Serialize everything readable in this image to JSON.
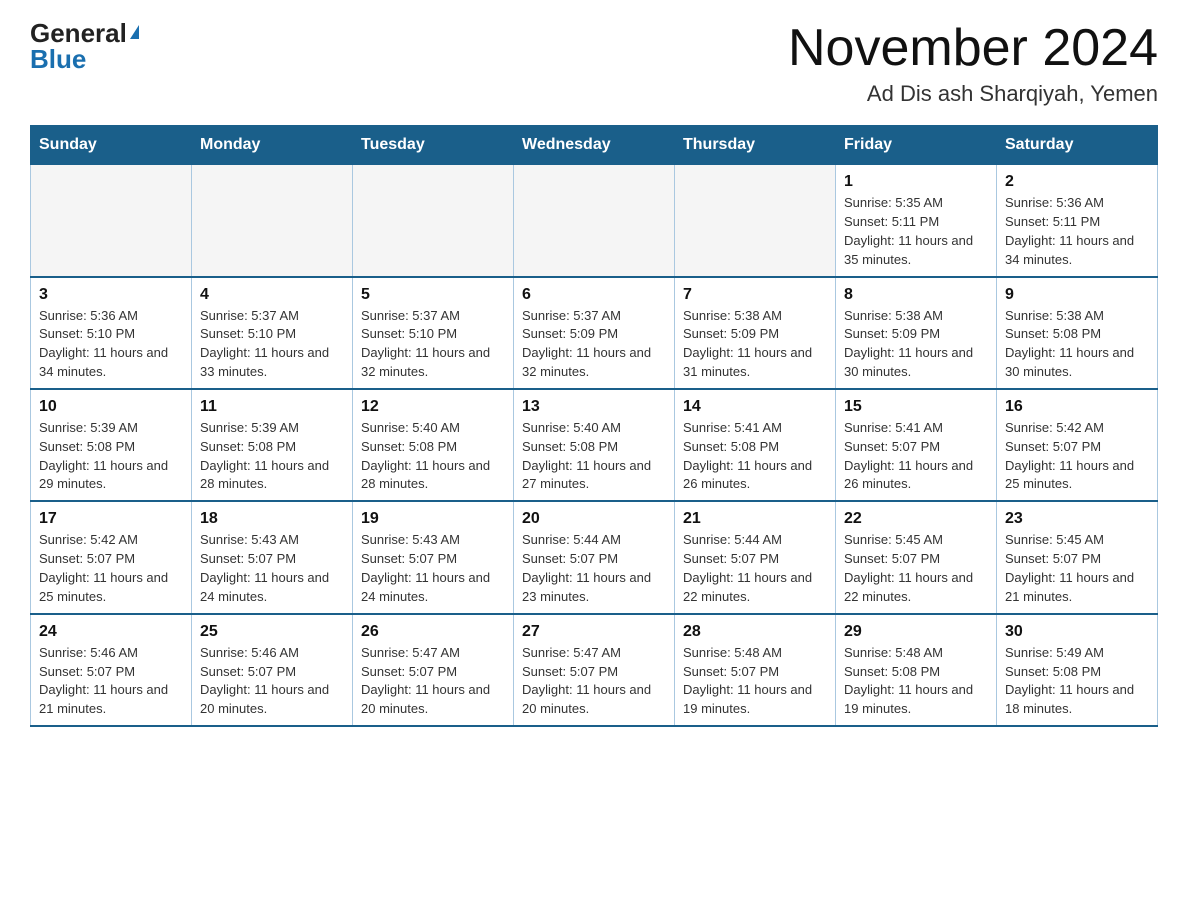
{
  "logo": {
    "general": "General",
    "triangle": "▶",
    "blue": "Blue"
  },
  "header": {
    "title": "November 2024",
    "subtitle": "Ad Dis ash Sharqiyah, Yemen"
  },
  "days_of_week": [
    "Sunday",
    "Monday",
    "Tuesday",
    "Wednesday",
    "Thursday",
    "Friday",
    "Saturday"
  ],
  "weeks": [
    [
      {
        "day": "",
        "info": ""
      },
      {
        "day": "",
        "info": ""
      },
      {
        "day": "",
        "info": ""
      },
      {
        "day": "",
        "info": ""
      },
      {
        "day": "",
        "info": ""
      },
      {
        "day": "1",
        "info": "Sunrise: 5:35 AM\nSunset: 5:11 PM\nDaylight: 11 hours and 35 minutes."
      },
      {
        "day": "2",
        "info": "Sunrise: 5:36 AM\nSunset: 5:11 PM\nDaylight: 11 hours and 34 minutes."
      }
    ],
    [
      {
        "day": "3",
        "info": "Sunrise: 5:36 AM\nSunset: 5:10 PM\nDaylight: 11 hours and 34 minutes."
      },
      {
        "day": "4",
        "info": "Sunrise: 5:37 AM\nSunset: 5:10 PM\nDaylight: 11 hours and 33 minutes."
      },
      {
        "day": "5",
        "info": "Sunrise: 5:37 AM\nSunset: 5:10 PM\nDaylight: 11 hours and 32 minutes."
      },
      {
        "day": "6",
        "info": "Sunrise: 5:37 AM\nSunset: 5:09 PM\nDaylight: 11 hours and 32 minutes."
      },
      {
        "day": "7",
        "info": "Sunrise: 5:38 AM\nSunset: 5:09 PM\nDaylight: 11 hours and 31 minutes."
      },
      {
        "day": "8",
        "info": "Sunrise: 5:38 AM\nSunset: 5:09 PM\nDaylight: 11 hours and 30 minutes."
      },
      {
        "day": "9",
        "info": "Sunrise: 5:38 AM\nSunset: 5:08 PM\nDaylight: 11 hours and 30 minutes."
      }
    ],
    [
      {
        "day": "10",
        "info": "Sunrise: 5:39 AM\nSunset: 5:08 PM\nDaylight: 11 hours and 29 minutes."
      },
      {
        "day": "11",
        "info": "Sunrise: 5:39 AM\nSunset: 5:08 PM\nDaylight: 11 hours and 28 minutes."
      },
      {
        "day": "12",
        "info": "Sunrise: 5:40 AM\nSunset: 5:08 PM\nDaylight: 11 hours and 28 minutes."
      },
      {
        "day": "13",
        "info": "Sunrise: 5:40 AM\nSunset: 5:08 PM\nDaylight: 11 hours and 27 minutes."
      },
      {
        "day": "14",
        "info": "Sunrise: 5:41 AM\nSunset: 5:08 PM\nDaylight: 11 hours and 26 minutes."
      },
      {
        "day": "15",
        "info": "Sunrise: 5:41 AM\nSunset: 5:07 PM\nDaylight: 11 hours and 26 minutes."
      },
      {
        "day": "16",
        "info": "Sunrise: 5:42 AM\nSunset: 5:07 PM\nDaylight: 11 hours and 25 minutes."
      }
    ],
    [
      {
        "day": "17",
        "info": "Sunrise: 5:42 AM\nSunset: 5:07 PM\nDaylight: 11 hours and 25 minutes."
      },
      {
        "day": "18",
        "info": "Sunrise: 5:43 AM\nSunset: 5:07 PM\nDaylight: 11 hours and 24 minutes."
      },
      {
        "day": "19",
        "info": "Sunrise: 5:43 AM\nSunset: 5:07 PM\nDaylight: 11 hours and 24 minutes."
      },
      {
        "day": "20",
        "info": "Sunrise: 5:44 AM\nSunset: 5:07 PM\nDaylight: 11 hours and 23 minutes."
      },
      {
        "day": "21",
        "info": "Sunrise: 5:44 AM\nSunset: 5:07 PM\nDaylight: 11 hours and 22 minutes."
      },
      {
        "day": "22",
        "info": "Sunrise: 5:45 AM\nSunset: 5:07 PM\nDaylight: 11 hours and 22 minutes."
      },
      {
        "day": "23",
        "info": "Sunrise: 5:45 AM\nSunset: 5:07 PM\nDaylight: 11 hours and 21 minutes."
      }
    ],
    [
      {
        "day": "24",
        "info": "Sunrise: 5:46 AM\nSunset: 5:07 PM\nDaylight: 11 hours and 21 minutes."
      },
      {
        "day": "25",
        "info": "Sunrise: 5:46 AM\nSunset: 5:07 PM\nDaylight: 11 hours and 20 minutes."
      },
      {
        "day": "26",
        "info": "Sunrise: 5:47 AM\nSunset: 5:07 PM\nDaylight: 11 hours and 20 minutes."
      },
      {
        "day": "27",
        "info": "Sunrise: 5:47 AM\nSunset: 5:07 PM\nDaylight: 11 hours and 20 minutes."
      },
      {
        "day": "28",
        "info": "Sunrise: 5:48 AM\nSunset: 5:07 PM\nDaylight: 11 hours and 19 minutes."
      },
      {
        "day": "29",
        "info": "Sunrise: 5:48 AM\nSunset: 5:08 PM\nDaylight: 11 hours and 19 minutes."
      },
      {
        "day": "30",
        "info": "Sunrise: 5:49 AM\nSunset: 5:08 PM\nDaylight: 11 hours and 18 minutes."
      }
    ]
  ]
}
